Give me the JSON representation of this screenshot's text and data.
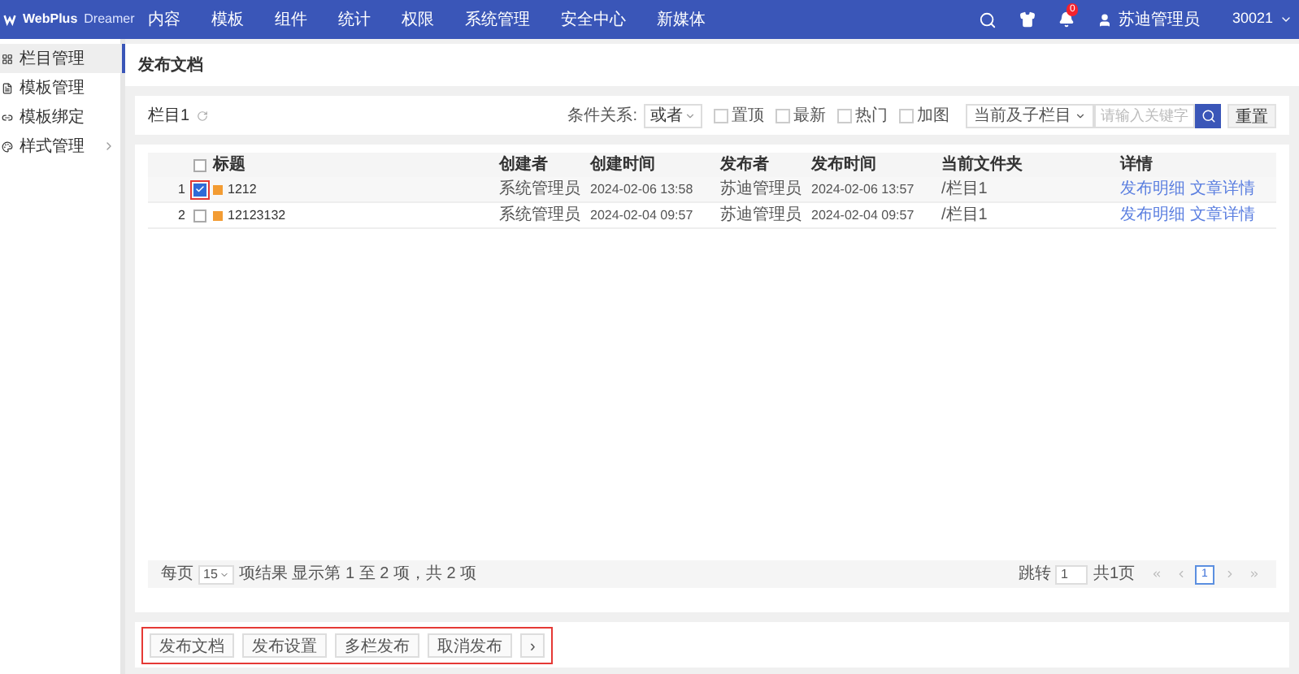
{
  "topbar": {
    "logo": {
      "brand": "WebPlus",
      "product": "Dreamer"
    },
    "nav": [
      {
        "label": "内容"
      },
      {
        "label": "模板"
      },
      {
        "label": "组件"
      },
      {
        "label": "统计"
      },
      {
        "label": "权限"
      },
      {
        "label": "系统管理"
      },
      {
        "label": "安全中心"
      },
      {
        "label": "新媒体"
      }
    ],
    "notification_count": "0",
    "user": "苏迪管理员",
    "site": "30021"
  },
  "sidebar": {
    "items": [
      {
        "label": "栏目管理",
        "selected": true,
        "has_children": false
      },
      {
        "label": "模板管理",
        "selected": false,
        "has_children": false
      },
      {
        "label": "模板绑定",
        "selected": false,
        "has_children": false
      },
      {
        "label": "样式管理",
        "selected": false,
        "has_children": true
      }
    ]
  },
  "page_title": "发布文档",
  "filter": {
    "column": "栏目1",
    "relation_label": "条件关系:",
    "relation": "或者",
    "flags": [
      {
        "label": "置顶",
        "checked": false
      },
      {
        "label": "最新",
        "checked": false
      },
      {
        "label": "热门",
        "checked": false
      },
      {
        "label": "加图",
        "checked": false
      }
    ],
    "scope": "当前及子栏目",
    "search_placeholder": "请输入关键字",
    "reset": "重置"
  },
  "table": {
    "select_all_checked": false,
    "columns": [
      "标题",
      "创建者",
      "创建时间",
      "发布者",
      "发布时间",
      "当前文件夹",
      "详情"
    ],
    "rows": [
      {
        "index": "1",
        "selected": true,
        "highlighted": true,
        "title": "1212",
        "creator": "系统管理员",
        "created": "2024-02-06 13:58",
        "publisher": "苏迪管理员",
        "published": "2024-02-06 13:57",
        "folder": "/栏目1",
        "links": [
          "发布明细",
          "文章详情"
        ]
      },
      {
        "index": "2",
        "selected": false,
        "highlighted": false,
        "title": "12123132",
        "creator": "系统管理员",
        "created": "2024-02-04 09:57",
        "publisher": "苏迪管理员",
        "published": "2024-02-04 09:57",
        "folder": "/栏目1",
        "links": [
          "发布明细",
          "文章详情"
        ]
      }
    ]
  },
  "pagination": {
    "per_page_label": "每页",
    "per_page": "15",
    "summary": "项结果 显示第 1 至 2 项，共 2 项",
    "jump_label": "跳转",
    "jump_value": "1",
    "total_pages": "共1页",
    "pages": [
      {
        "label": "1",
        "selected": true
      }
    ]
  },
  "actions": {
    "highlighted": true,
    "buttons": [
      "发布文档",
      "发布设置",
      "多栏发布",
      "取消发布",
      "›"
    ]
  }
}
